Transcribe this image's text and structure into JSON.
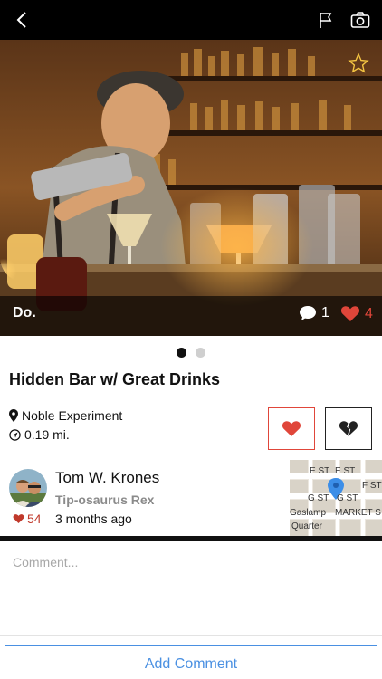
{
  "nav": {
    "back_icon": "chevron-left-icon",
    "flag_icon": "flag-icon",
    "camera_icon": "camera-icon"
  },
  "post": {
    "category": "Do.",
    "comment_count": "1",
    "like_count": "4",
    "favorite_icon": "star-outline-icon",
    "carousel": {
      "pages": 2,
      "current": 1
    },
    "title": "Hidden Bar w/ Great Drinks",
    "venue": "Noble Experiment",
    "distance": "0.19 mi."
  },
  "actions": {
    "like_icon": "heart-icon",
    "dislike_icon": "broken-heart-icon"
  },
  "author": {
    "name": "Tom W. Krones",
    "rank": "Tip-osaurus Rex",
    "score": "54",
    "posted": "3 months ago"
  },
  "map": {
    "labels": [
      "E ST",
      "E ST",
      "F ST",
      "G ST",
      "G ST",
      "Gaslamp",
      "MARKET S",
      "Quarter"
    ]
  },
  "comment": {
    "placeholder": "Comment...",
    "submit_label": "Add Comment"
  },
  "colors": {
    "accent_red": "#e0463a",
    "link_blue": "#4a90e2",
    "rank_gray": "#8a8a8a"
  }
}
